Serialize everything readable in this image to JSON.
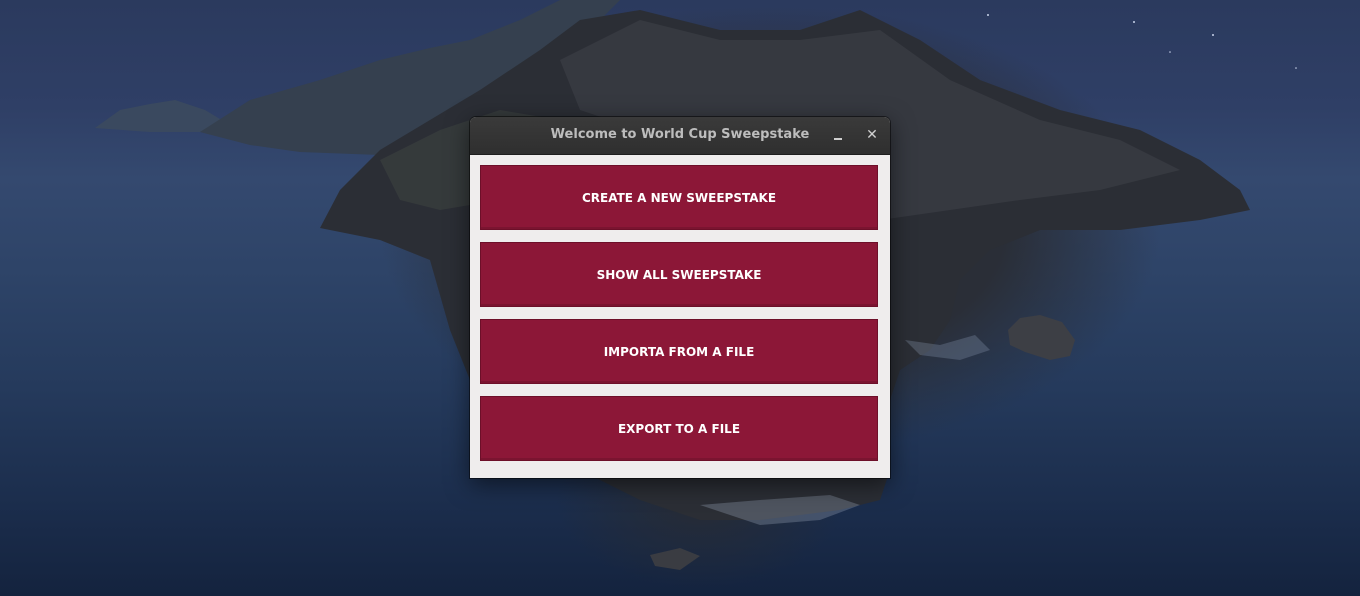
{
  "window": {
    "title": "Welcome to World Cup Sweepstake",
    "minimize_icon": "minimize-icon",
    "close_icon": "close-icon",
    "close_glyph": "✕"
  },
  "actions": [
    {
      "label": "CREATE A NEW SWEEPSTAKE"
    },
    {
      "label": "SHOW ALL SWEEPSTAKE"
    },
    {
      "label": "IMPORTA FROM A FILE"
    },
    {
      "label": "EXPORT TO A FILE"
    }
  ],
  "colors": {
    "button_bg": "#8c1737",
    "titlebar_bg": "#333333",
    "window_bg": "#efeded"
  }
}
